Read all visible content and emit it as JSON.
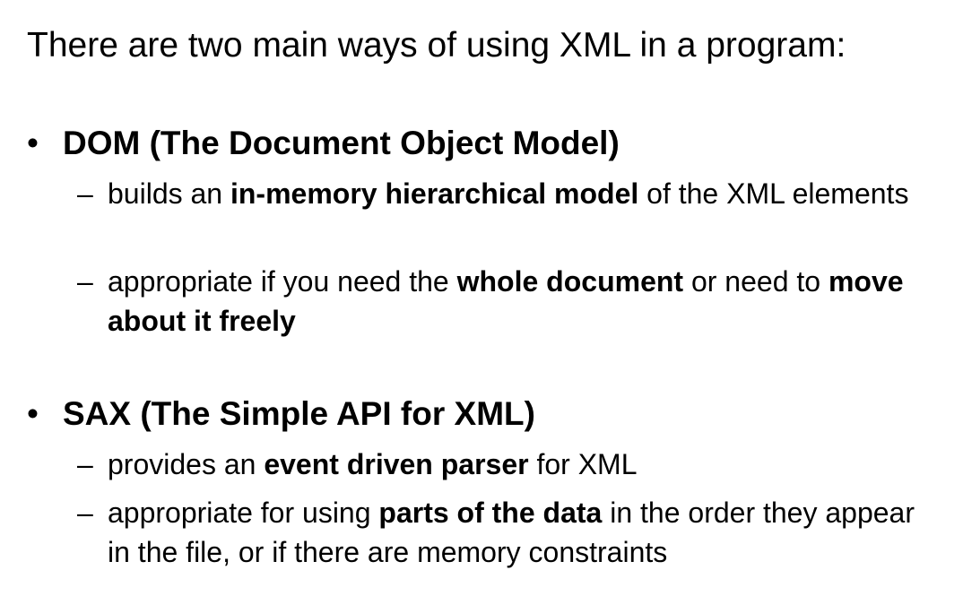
{
  "intro": "There are two main ways of using XML in a program:",
  "bullet_char": "•",
  "dash_char": "–",
  "sections": [
    {
      "title": "DOM (The Document Object Model)",
      "items": [
        {
          "pre": "builds an ",
          "bold": "in-memory hierarchical model",
          "post": " of the XML elements"
        },
        {
          "pre": "appropriate if you need the ",
          "bold": "whole document",
          "mid": " or need to ",
          "bold2": "move about it freely"
        }
      ]
    },
    {
      "title": "SAX (The Simple API for XML)",
      "items": [
        {
          "pre": "provides an ",
          "bold": "event driven parser",
          "post": " for XML"
        },
        {
          "pre": "appropriate for using ",
          "bold": "parts of the data",
          "post": " in the order they appear in the file, or if there are memory constraints"
        }
      ]
    }
  ]
}
